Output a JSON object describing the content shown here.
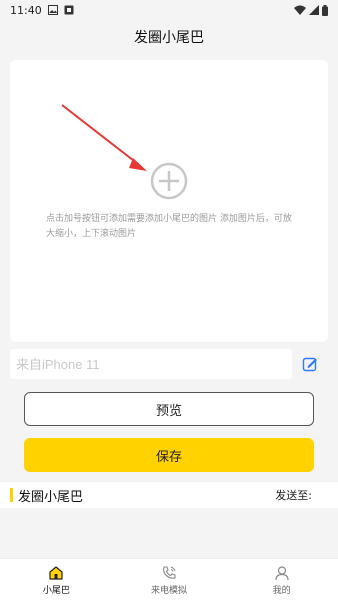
{
  "status_bar": {
    "time": "11:40",
    "icons": [
      "image-icon",
      "notification-icon",
      "wifi-icon",
      "signal-icon",
      "battery-icon"
    ]
  },
  "header": {
    "title": "发圈小尾巴"
  },
  "upload": {
    "hint": "点击加号按钮可添加需要添加小尾巴的图片 添加图片后，可放大缩小，上下滚动图片",
    "icon": "add-circle-icon",
    "annotation_color": "#e53935"
  },
  "source": {
    "placeholder": "来自iPhone 11",
    "value": ""
  },
  "actions": {
    "preview_label": "预览",
    "save_label": "保存"
  },
  "tail": {
    "name": "发圈小尾巴",
    "send_to_label": "发送至:"
  },
  "tab_bar": {
    "items": [
      {
        "label": "小尾巴",
        "icon": "home-icon",
        "active": true
      },
      {
        "label": "来电模拟",
        "icon": "phone-call-icon",
        "active": false
      },
      {
        "label": "我的",
        "icon": "user-icon",
        "active": false
      }
    ]
  },
  "colors": {
    "accent": "#ffd200",
    "edit_icon": "#2e7bf6",
    "background": "#f4f4f4"
  }
}
